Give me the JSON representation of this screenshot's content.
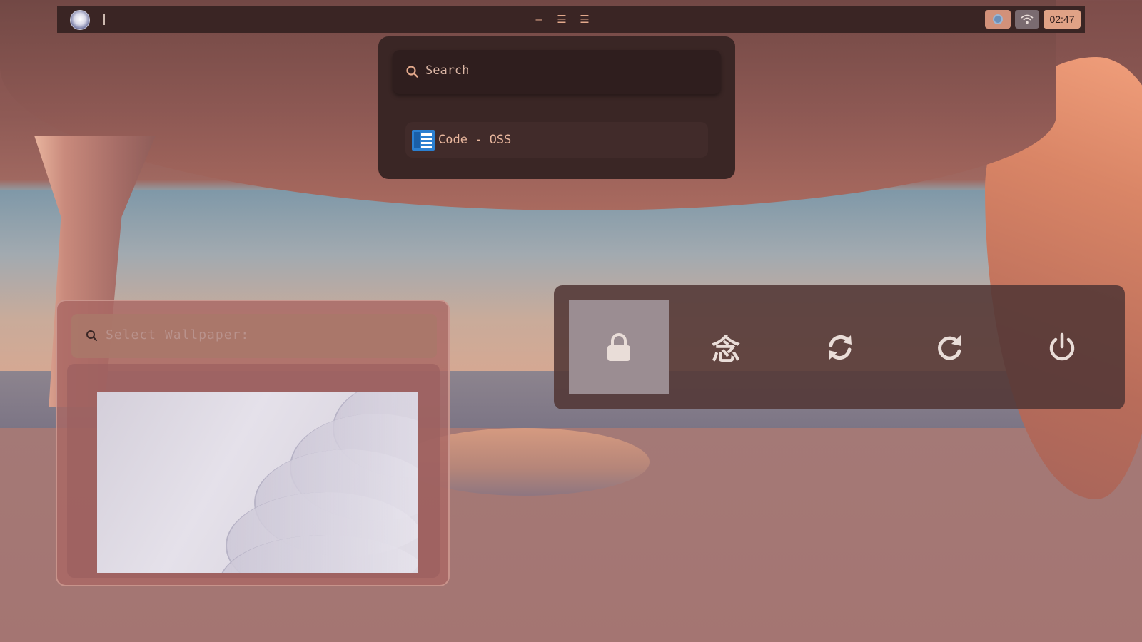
{
  "topbar": {
    "workspaces": [
      {
        "name": "workspace-1",
        "glyph": "—"
      },
      {
        "name": "workspace-2",
        "glyph": "☰"
      },
      {
        "name": "workspace-3",
        "glyph": "☰"
      }
    ],
    "tray": {
      "clock": "02:47"
    }
  },
  "launcher": {
    "search_placeholder": "Search",
    "results": [
      {
        "label": "Code - OSS",
        "icon": "vscode-icon"
      }
    ]
  },
  "wallpaper_picker": {
    "search_placeholder": "Select Wallpaper:"
  },
  "power_menu": {
    "buttons": [
      {
        "name": "lock",
        "icon": "lock-icon",
        "selected": true
      },
      {
        "name": "logout",
        "glyph": "念",
        "icon": "kanji-icon"
      },
      {
        "name": "suspend",
        "icon": "refresh-icon"
      },
      {
        "name": "reboot",
        "icon": "restart-icon"
      },
      {
        "name": "shutdown",
        "icon": "power-icon"
      }
    ]
  },
  "colors": {
    "panel": "#3a2625",
    "accent": "#e0a286",
    "text": "#e9b79e",
    "selected": "#9b8d92"
  }
}
